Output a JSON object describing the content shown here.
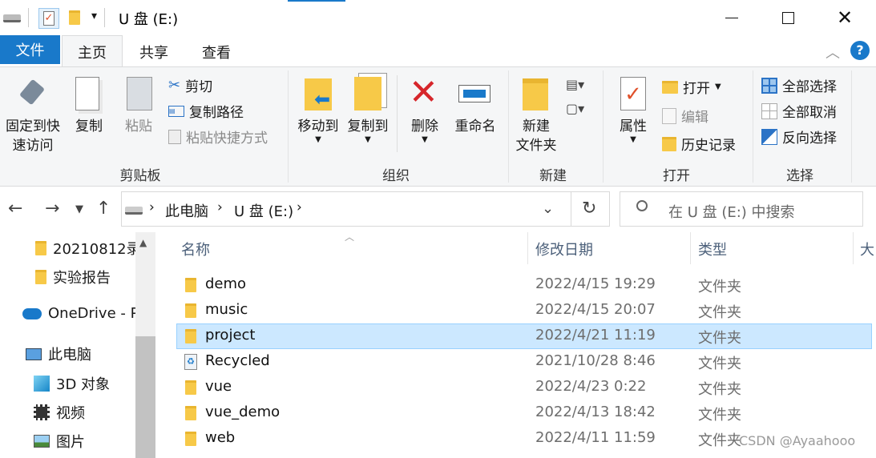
{
  "window": {
    "title": "U 盘 (E:)"
  },
  "tabs": {
    "file": "文件",
    "home": "主页",
    "share": "共享",
    "view": "查看"
  },
  "ribbon": {
    "clipboard": {
      "pin": "固定到快",
      "pin2": "速访问",
      "copy": "复制",
      "paste": "粘贴",
      "cut": "剪切",
      "copy_path": "复制路径",
      "paste_shortcut": "粘贴快捷方式",
      "label": "剪贴板"
    },
    "organize": {
      "move_to": "移动到",
      "copy_to": "复制到",
      "delete": "删除",
      "rename": "重命名",
      "label": "组织"
    },
    "new": {
      "new_folder": "新建",
      "new_folder2": "文件夹",
      "label": "新建"
    },
    "open": {
      "properties": "属性",
      "open": "打开",
      "edit": "编辑",
      "history": "历史记录",
      "label": "打开"
    },
    "select": {
      "select_all": "全部选择",
      "select_none": "全部取消",
      "invert": "反向选择",
      "label": "选择"
    }
  },
  "address": {
    "crumb1": "此电脑",
    "crumb2": "U 盘 (E:)",
    "search_placeholder": "在 U 盘 (E:) 中搜索"
  },
  "nav": {
    "items": [
      "20210812录",
      "实验报告",
      "OneDrive - P",
      "此电脑",
      "3D 对象",
      "视频",
      "图片"
    ]
  },
  "columns": {
    "name": "名称",
    "date": "修改日期",
    "type": "类型",
    "size": "大"
  },
  "files": [
    {
      "name": "demo",
      "date": "2022/4/15 19:29",
      "type": "文件夹"
    },
    {
      "name": "music",
      "date": "2022/4/15 20:07",
      "type": "文件夹"
    },
    {
      "name": "project",
      "date": "2022/4/21 11:19",
      "type": "文件夹"
    },
    {
      "name": "Recycled",
      "date": "2021/10/28 8:46",
      "type": "文件夹"
    },
    {
      "name": "vue",
      "date": "2022/4/23 0:22",
      "type": "文件夹"
    },
    {
      "name": "vue_demo",
      "date": "2022/4/13 18:42",
      "type": "文件夹"
    },
    {
      "name": "web",
      "date": "2022/4/11 11:59",
      "type": "文件夹"
    }
  ],
  "watermark": "CSDN @Ayaahooo"
}
